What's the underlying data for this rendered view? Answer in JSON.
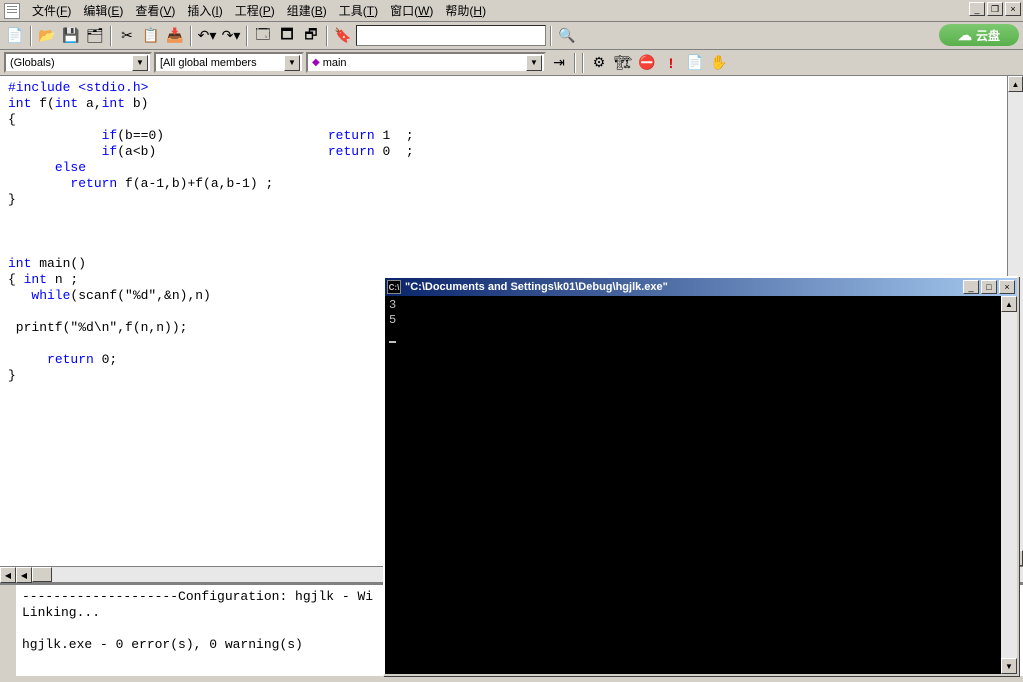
{
  "menu": {
    "items": [
      {
        "label": "文件",
        "accel": "F"
      },
      {
        "label": "编辑",
        "accel": "E"
      },
      {
        "label": "查看",
        "accel": "V"
      },
      {
        "label": "插入",
        "accel": "I"
      },
      {
        "label": "工程",
        "accel": "P"
      },
      {
        "label": "组建",
        "accel": "B"
      },
      {
        "label": "工具",
        "accel": "T"
      },
      {
        "label": "窗口",
        "accel": "W"
      },
      {
        "label": "帮助",
        "accel": "H"
      }
    ]
  },
  "toolbar": {
    "icons": [
      "new-doc",
      "open",
      "save",
      "save-all",
      "cut",
      "copy",
      "paste",
      "undo",
      "redo",
      "window-list",
      "tile-h",
      "tile-v",
      "bookmark"
    ],
    "cloud_label": "云盘"
  },
  "context_bar": {
    "scope": "(Globals)",
    "members": "[All global members",
    "function": "main",
    "icons": [
      "go",
      "stop",
      "breakpoint",
      "step",
      "watch",
      "hand"
    ]
  },
  "code": {
    "lines": [
      {
        "t": "#include <stdio.h>",
        "cls": "pp"
      },
      {
        "t": "int f(int a,int b)",
        "seg": [
          [
            "kw",
            "int"
          ],
          [
            "",
            " f("
          ],
          [
            "kw",
            "int"
          ],
          [
            "",
            " a,"
          ],
          [
            "kw",
            "int"
          ],
          [
            "",
            " b)"
          ]
        ]
      },
      {
        "t": "{"
      },
      {
        "t": "            if(b==0)                     return 1  ;",
        "seg": [
          [
            "",
            "            "
          ],
          [
            "kw",
            "if"
          ],
          [
            "",
            "(b==0)                     "
          ],
          [
            "kw",
            "return"
          ],
          [
            "",
            " 1  ;"
          ]
        ]
      },
      {
        "t": "            if(a<b)                      return 0  ;",
        "seg": [
          [
            "",
            "            "
          ],
          [
            "kw",
            "if"
          ],
          [
            "",
            "(a<b)                      "
          ],
          [
            "kw",
            "return"
          ],
          [
            "",
            " 0  ;"
          ]
        ]
      },
      {
        "t": "      else",
        "seg": [
          [
            "",
            "      "
          ],
          [
            "kw",
            "else"
          ]
        ]
      },
      {
        "t": "        return f(a-1,b)+f(a,b-1) ;",
        "seg": [
          [
            "",
            "        "
          ],
          [
            "kw",
            "return"
          ],
          [
            "",
            " f(a-1,b)+f(a,b-1) ;"
          ]
        ]
      },
      {
        "t": "}"
      },
      {
        "t": ""
      },
      {
        "t": ""
      },
      {
        "t": ""
      },
      {
        "t": "int main()",
        "seg": [
          [
            "kw",
            "int"
          ],
          [
            "",
            " main()"
          ]
        ]
      },
      {
        "t": "{ int n ;",
        "seg": [
          [
            "",
            "{ "
          ],
          [
            "kw",
            "int"
          ],
          [
            "",
            " n ;"
          ]
        ]
      },
      {
        "t": "   while(scanf(\"%d\",&n),n)",
        "seg": [
          [
            "",
            "   "
          ],
          [
            "kw",
            "while"
          ],
          [
            "",
            "(scanf(\"%d\",&n),n)"
          ]
        ]
      },
      {
        "t": ""
      },
      {
        "t": " printf(\"%d\\n\",f(n,n));"
      },
      {
        "t": ""
      },
      {
        "t": "     return 0;",
        "seg": [
          [
            "",
            "     "
          ],
          [
            "kw",
            "return"
          ],
          [
            "",
            " 0;"
          ]
        ]
      },
      {
        "t": "}"
      }
    ]
  },
  "output": {
    "lines": [
      "--------------------Configuration: hgjlk - Wi",
      "Linking...",
      "",
      "hgjlk.exe - 0 error(s), 0 warning(s)"
    ]
  },
  "console": {
    "title": "\"C:\\Documents and Settings\\k01\\Debug\\hgjlk.exe\"",
    "lines": [
      "3",
      "5"
    ]
  }
}
